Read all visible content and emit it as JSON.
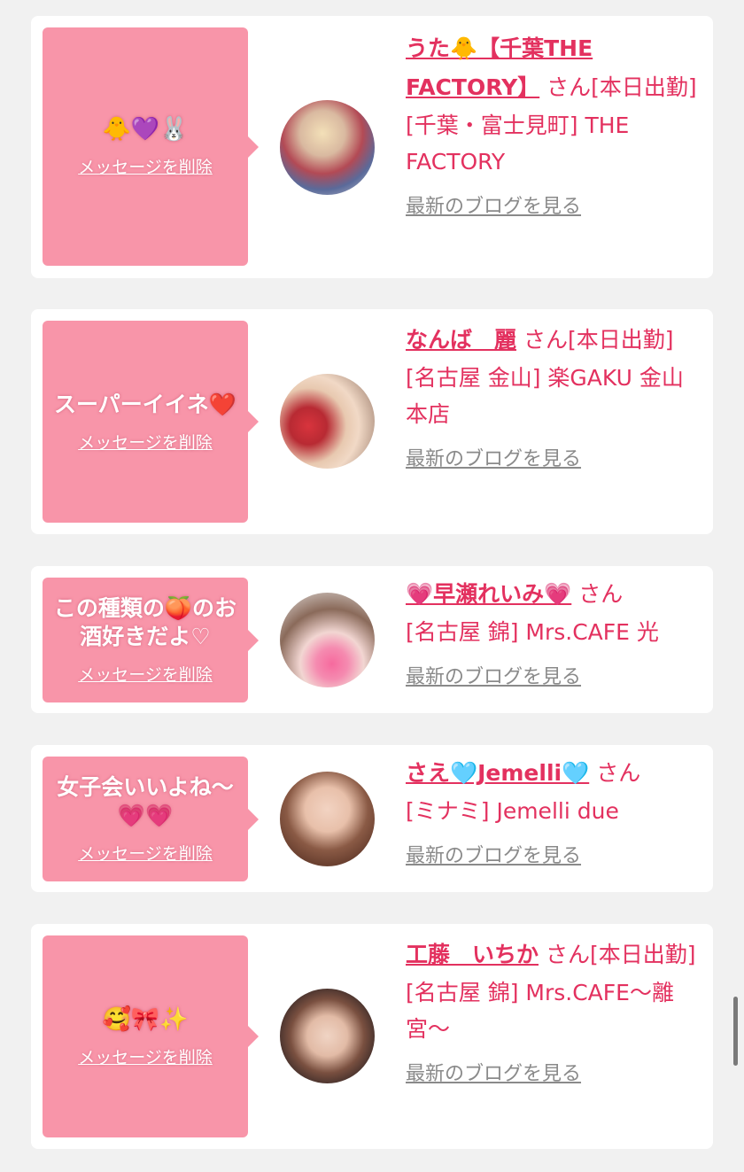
{
  "cards": [
    {
      "message": "🐥💜🐰",
      "delete_label": "メッセージを削除",
      "name": "うた🐥【千葉THE FACTORY】",
      "honorific": "さん",
      "status": "[本日出勤]",
      "shop": "[千葉・富士見町] THE FACTORY",
      "blog_label": "最新のブログを見る",
      "avatar_icon": "profile-photo"
    },
    {
      "message": "スーパーイイネ❤️",
      "delete_label": "メッセージを削除",
      "name": "なんば　麗",
      "honorific": "さん",
      "status": "[本日出勤]",
      "shop": "[名古屋 金山] 楽GAKU 金山本店",
      "blog_label": "最新のブログを見る",
      "avatar_icon": "profile-photo"
    },
    {
      "message": "この種類の🍑のお酒好きだよ♡",
      "delete_label": "メッセージを削除",
      "name": "💗早瀬れいみ💗",
      "honorific": "さん",
      "status": "",
      "shop": "[名古屋 錦] Mrs.CAFE 光",
      "blog_label": "最新のブログを見る",
      "avatar_icon": "profile-photo"
    },
    {
      "message": "女子会いいよね〜💗💗",
      "delete_label": "メッセージを削除",
      "name": "さえ🩵Jemelli🩵",
      "honorific": "さん",
      "status": "",
      "shop": "[ミナミ] Jemelli due",
      "blog_label": "最新のブログを見る",
      "avatar_icon": "profile-photo"
    },
    {
      "message": "🥰🎀✨",
      "delete_label": "メッセージを削除",
      "name": "工藤　いちか",
      "honorific": "さん",
      "status": "[本日出勤]",
      "shop": "[名古屋 錦] Mrs.CAFE〜離宮〜",
      "blog_label": "最新のブログを見る",
      "avatar_icon": "profile-photo"
    }
  ],
  "colors": {
    "accent": "#e3315f",
    "bubble": "#f895a9",
    "background": "#f1f1f1"
  }
}
